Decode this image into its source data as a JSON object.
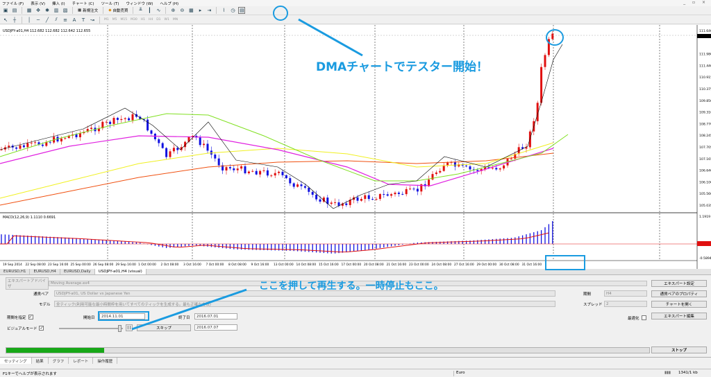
{
  "menubar": {
    "items": [
      "ファイル (F)",
      "表示 (V)",
      "挿入 (I)",
      "チャート (C)",
      "ツール (T)",
      "ウィンドウ (W)",
      "ヘルプ (H)"
    ]
  },
  "toolbar": {
    "new_order": "新規注文",
    "auto_trading": "自動売買",
    "timeframes": [
      "M1",
      "M5",
      "M15",
      "M30",
      "H1",
      "H4",
      "D1",
      "W1",
      "MN"
    ]
  },
  "chart": {
    "info": "USDJPY-a01,H4  112.682 112.682 112.642 112.655",
    "macd_label": "MACD(12,26,9) 1.1110 0.6691",
    "price_ticks": [
      "111.640",
      "112.655",
      "111.980",
      "111.440",
      "110.915",
      "110.375",
      "109.850",
      "109.310",
      "108.770",
      "108.245",
      "107.705",
      "107.165",
      "106.640",
      "106.100",
      "105.560",
      "105.035"
    ],
    "macd_ticks": [
      "1.1919",
      "0.0000",
      "-0.5894"
    ],
    "time_ticks": [
      "19 Sep 2014",
      "22 Sep 08:00",
      "23 Sep 16:00",
      "25 Sep 00:00",
      "26 Sep 08:00",
      "29 Sep 16:00",
      "1 Oct 00:00",
      "2 Oct 08:00",
      "3 Oct 16:00",
      "7 Oct 00:00",
      "8 Oct 08:00",
      "9 Oct 16:00",
      "13 Oct 00:00",
      "14 Oct 08:00",
      "15 Oct 16:00",
      "17 Oct 00:00",
      "20 Oct 08:00",
      "21 Oct 16:00",
      "23 Oct 00:00",
      "24 Oct 08:00",
      "27 Oct 16:00",
      "29 Oct 00:00",
      "30 Oct 08:00",
      "31 Oct 16:00"
    ],
    "colors": {
      "bull": "#e01010",
      "bear": "#1010e0",
      "ma_fast": "#000000",
      "ma_green": "#80e020",
      "ma_magenta": "#e020e0",
      "ma_yellow": "#f0f020",
      "ma_orange": "#f05010",
      "macd_signal": "#e01010"
    }
  },
  "chart_tabs": [
    "EURUSD,H1",
    "EURUSD,H4",
    "EURUSD,Daily",
    "USDJPY-a01,H4 (visual)"
  ],
  "tester": {
    "ea_label": "エキスパートアドバイザ",
    "ea_value": "Moving Average.ex4",
    "symbol_label": "通貨ペア",
    "symbol_value": "USDJPY-a01, US Dollar vs Japanese Yen",
    "model_label": "モデル",
    "model_value": "全ティック(利用可能な最小時間枠を用いてすべてのティックを生成する。最も正確な方法)",
    "period_spec_label": "期間を指定",
    "start_label": "開始日",
    "start_value": "2014.11.01",
    "end_label": "終了日",
    "end_value": "2016.07.01",
    "visual_label": "ビジュアルモード",
    "pause_label": "| |",
    "skip_label": "スキップ",
    "skip_date": "2016.07.07",
    "timeframe_label": "期間",
    "timeframe_value": "H4",
    "spread_label": "スプレッド",
    "spread_value": "2",
    "optimize_label": "最適化",
    "btn_expert_settings": "エキスパート設定",
    "btn_symbol_props": "通貨ペアのプロパティ",
    "btn_open_chart": "チャートを開く",
    "btn_edit_expert": "エキスパート編集",
    "btn_stop": "ストップ",
    "progress": 0.152
  },
  "bottom_tabs": [
    "セッティング",
    "結果",
    "グラフ",
    "レポート",
    "操作履歴"
  ],
  "status": {
    "help": "F1キーでヘルプが表示されます",
    "profile": "Euro",
    "traffic": "1341/1 kb"
  },
  "annotations": {
    "dma": "DMAチャートでテスター開始！",
    "play": "ここを押して再生する。一時停止もここ。"
  }
}
